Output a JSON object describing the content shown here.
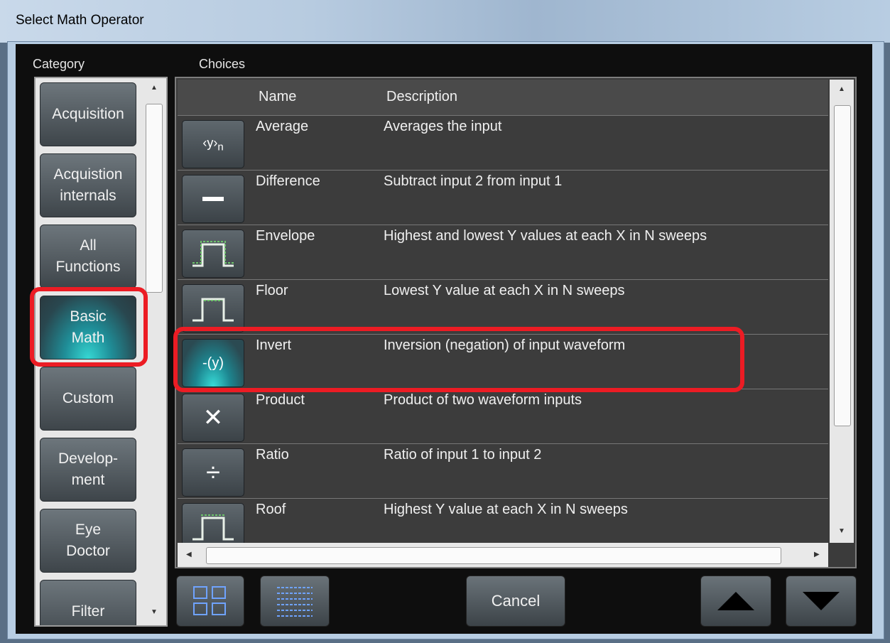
{
  "window": {
    "title": "Select Math Operator"
  },
  "labels": {
    "category": "Category",
    "choices": "Choices"
  },
  "categories": [
    {
      "label": "Acquisition",
      "selected": false
    },
    {
      "label": "Acquistion\ninternals",
      "selected": false
    },
    {
      "label": "All\nFunctions",
      "selected": false
    },
    {
      "label": "Basic\nMath",
      "selected": true
    },
    {
      "label": "Custom",
      "selected": false
    },
    {
      "label": "Develop-\nment",
      "selected": false
    },
    {
      "label": "Eye\nDoctor",
      "selected": false
    },
    {
      "label": "Filter",
      "selected": false
    }
  ],
  "table": {
    "columns": [
      "Name",
      "Description"
    ],
    "rows": [
      {
        "icon": "average-icon",
        "icon_text": "<y>",
        "name": "Average",
        "description": "Averages the input"
      },
      {
        "icon": "minus-icon",
        "icon_text": "",
        "name": "Difference",
        "description": "Subtract input 2 from input 1"
      },
      {
        "icon": "envelope-icon",
        "icon_text": "",
        "name": "Envelope",
        "description": "Highest and lowest Y values at each X in N sweeps"
      },
      {
        "icon": "floor-icon",
        "icon_text": "",
        "name": "Floor",
        "description": "Lowest Y value at each X in N sweeps"
      },
      {
        "icon": "invert-icon",
        "icon_text": "-(y)",
        "name": "Invert",
        "description": "Inversion (negation) of input waveform",
        "selected": true
      },
      {
        "icon": "multiply-icon",
        "icon_text": "✕",
        "name": "Product",
        "description": "Product of two waveform inputs"
      },
      {
        "icon": "divide-icon",
        "icon_text": "÷",
        "name": "Ratio",
        "description": "Ratio of input 1 to input 2"
      },
      {
        "icon": "roof-icon",
        "icon_text": "",
        "name": "Roof",
        "description": "Highest Y value at each X in N sweeps"
      }
    ]
  },
  "buttons": {
    "cancel": "Cancel"
  },
  "icons": {
    "up": "up-arrow-icon",
    "down": "down-arrow-icon",
    "grid": "grid-view-icon",
    "list": "list-view-icon"
  },
  "colors": {
    "highlight": "#ec1c24",
    "selected_glow": "#36d8d4"
  }
}
